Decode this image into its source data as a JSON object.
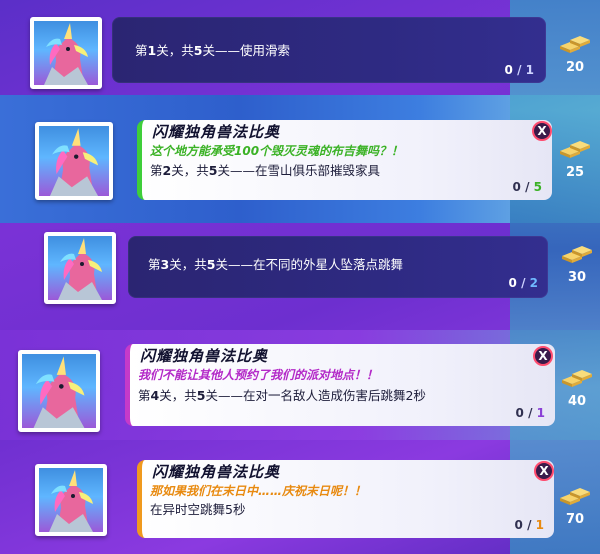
{
  "quests": [
    {
      "text_prefix": "第",
      "stage": "1",
      "text_mid": "关，共",
      "total_stages": "5",
      "text_suffix": "关——使用滑索",
      "progress_current": "0",
      "progress_total": "1",
      "reward": "20"
    },
    {
      "speaker": "闪耀独角兽法比奥",
      "speech": "这个地方能承受100个毁灭灵魂的布吉舞吗？！",
      "text_prefix": "第",
      "stage": "2",
      "text_mid": "关，共",
      "total_stages": "5",
      "text_suffix": "关——在雪山俱乐部摧毁家具",
      "progress_current": "0",
      "progress_total": "5",
      "reward": "25",
      "close": "X"
    },
    {
      "text_prefix": "第",
      "stage": "3",
      "text_mid": "关，共",
      "total_stages": "5",
      "text_suffix": "关——在不同的外星人坠落点跳舞",
      "progress_current": "0",
      "progress_total": "2",
      "reward": "30"
    },
    {
      "speaker": "闪耀独角兽法比奥",
      "speech": "我们不能让其他人预约了我们的派对地点！！",
      "text_prefix": "第",
      "stage": "4",
      "text_mid": "关，共",
      "total_stages": "5",
      "text_suffix": "关——在对一名敌人造成伤害后跳舞2秒",
      "progress_current": "0",
      "progress_total": "1",
      "reward": "40",
      "close": "X"
    },
    {
      "speaker": "闪耀独角兽法比奥",
      "speech": "那如果我们在末日中……庆祝末日呢！！",
      "text": "在异时空跳舞5秒",
      "progress_current": "0",
      "progress_total": "1",
      "reward": "70",
      "close": "X"
    }
  ],
  "colors": {
    "green": "#3bb226",
    "pink": "#b329c8",
    "orange": "#e88a10",
    "gold": "#f2c14e"
  },
  "icons": {
    "reward": "gold-bars-icon",
    "portrait": "unicorn-portrait",
    "close": "close-icon"
  }
}
